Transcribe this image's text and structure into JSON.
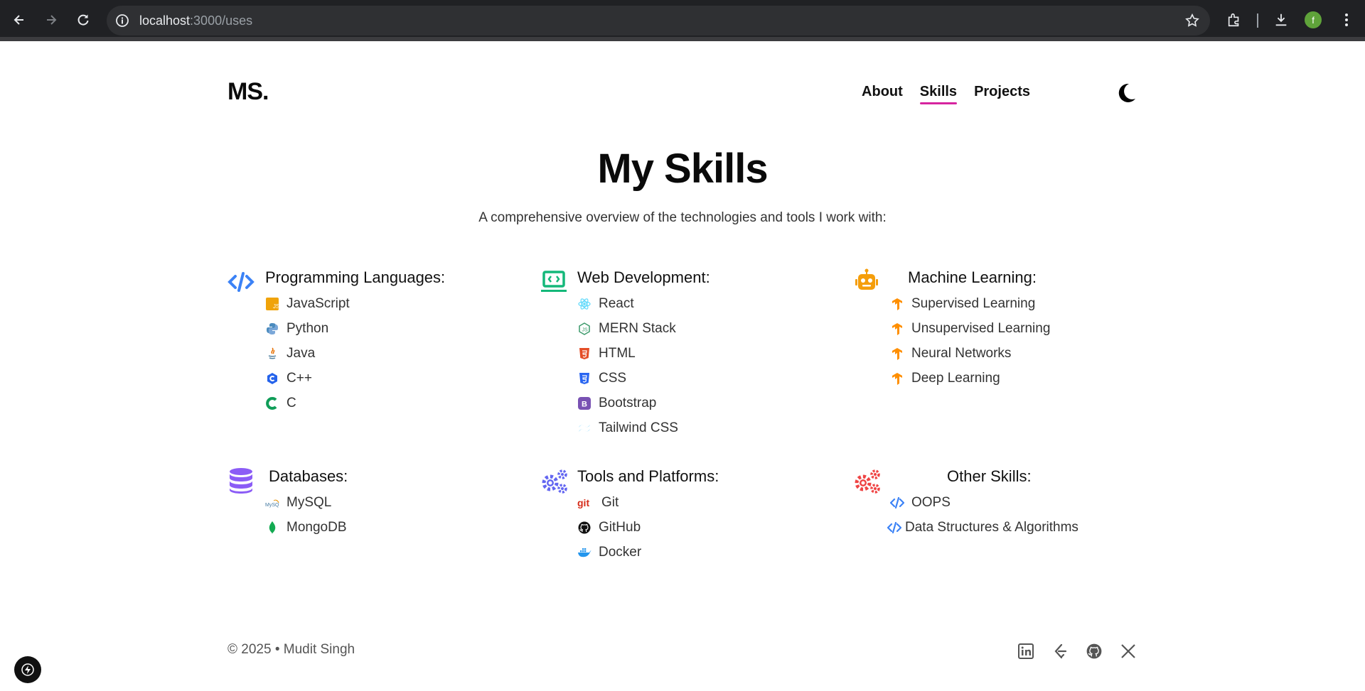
{
  "browser": {
    "url_host": "localhost",
    "url_path": ":3000/uses",
    "profile_initial": "f"
  },
  "header": {
    "logo": "MS.",
    "nav": [
      {
        "label": "About",
        "active": false
      },
      {
        "label": "Skills",
        "active": true
      },
      {
        "label": "Projects",
        "active": false
      }
    ],
    "theme_icon": "moon-icon"
  },
  "main": {
    "title": "My Skills",
    "subtitle": "A comprehensive overview of the technologies and tools I work with:",
    "categories": [
      {
        "title": "Programming Languages:",
        "icon": "code-icon",
        "items": [
          {
            "label": "JavaScript",
            "icon": "javascript-icon"
          },
          {
            "label": "Python",
            "icon": "python-icon"
          },
          {
            "label": "Java",
            "icon": "java-icon"
          },
          {
            "label": "C++",
            "icon": "cpp-icon"
          },
          {
            "label": "C",
            "icon": "c-icon"
          }
        ]
      },
      {
        "title": "Web Development:",
        "icon": "laptop-code-icon",
        "items": [
          {
            "label": "React",
            "icon": "react-icon"
          },
          {
            "label": "MERN Stack",
            "icon": "nodejs-icon"
          },
          {
            "label": "HTML",
            "icon": "html5-icon"
          },
          {
            "label": "CSS",
            "icon": "css3-icon"
          },
          {
            "label": "Bootstrap",
            "icon": "bootstrap-icon"
          },
          {
            "label": "Tailwind CSS",
            "icon": "tailwind-icon"
          }
        ]
      },
      {
        "title": "Machine Learning:",
        "icon": "robot-icon",
        "items": [
          {
            "label": "Supervised Learning",
            "icon": "tensorflow-icon"
          },
          {
            "label": "Unsupervised Learning",
            "icon": "tensorflow-icon"
          },
          {
            "label": "Neural Networks",
            "icon": "tensorflow-icon"
          },
          {
            "label": "Deep Learning",
            "icon": "tensorflow-icon"
          }
        ]
      },
      {
        "title": "Databases:",
        "icon": "database-icon",
        "items": [
          {
            "label": "MySQL",
            "icon": "mysql-icon"
          },
          {
            "label": "MongoDB",
            "icon": "mongodb-icon"
          }
        ]
      },
      {
        "title": "Tools and Platforms:",
        "icon": "gears-icon",
        "items": [
          {
            "label": "Git",
            "icon": "git-icon"
          },
          {
            "label": "GitHub",
            "icon": "github-icon"
          },
          {
            "label": "Docker",
            "icon": "docker-icon"
          }
        ]
      },
      {
        "title": "Other Skills:",
        "icon": "gears-red-icon",
        "items": [
          {
            "label": "OOPS",
            "icon": "code-icon"
          },
          {
            "label": "Data Structures & Algorithms",
            "icon": "code-icon"
          }
        ]
      }
    ]
  },
  "footer": {
    "copyright": "© 2025 • Mudit Singh",
    "socials": [
      "linkedin-icon",
      "leetcode-icon",
      "github-icon",
      "x-icon"
    ]
  },
  "colors": {
    "accent": "#d6249f",
    "code_blue": "#3b82f6",
    "teal": "#14b87a",
    "orange": "#f59e0b",
    "purple": "#8b5cf6",
    "indigo": "#6366f1",
    "red": "#ef4444"
  }
}
